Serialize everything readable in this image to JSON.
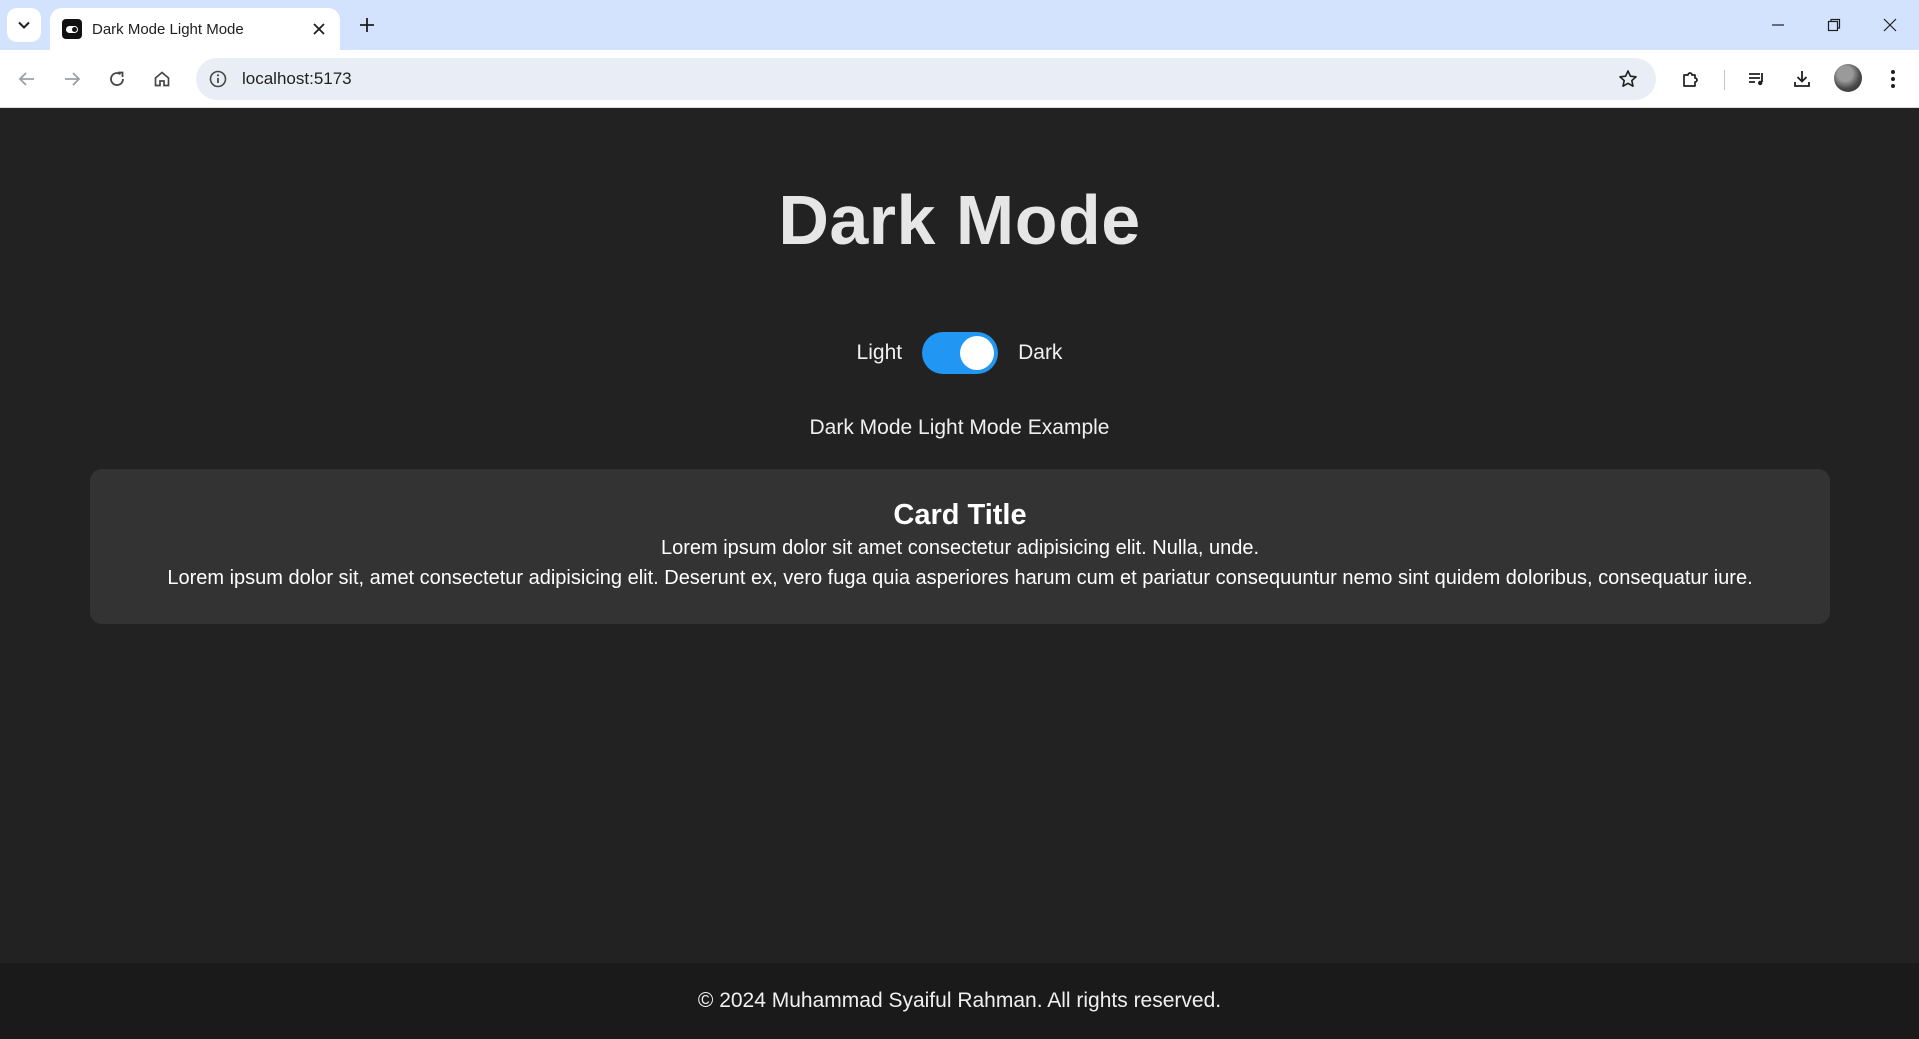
{
  "browser": {
    "tab": {
      "title": "Dark Mode Light Mode",
      "favicon": "toggle-icon"
    },
    "address_bar": {
      "url": "localhost:5173"
    },
    "icons": {
      "tab_search": "chevron-down-icon",
      "tab_close": "close-icon",
      "new_tab": "plus-icon",
      "minimize": "minimize-icon",
      "restore": "restore-icon",
      "close_window": "close-icon",
      "back": "arrow-left-icon",
      "forward": "arrow-right-icon",
      "reload": "reload-icon",
      "home": "home-icon",
      "site_info": "info-icon",
      "bookmark": "star-icon",
      "extensions": "puzzle-icon",
      "media": "media-queue-icon",
      "downloads": "download-icon",
      "profile": "avatar",
      "menu": "kebab-menu-icon"
    }
  },
  "page": {
    "title": "Dark Mode",
    "toggle": {
      "left_label": "Light",
      "right_label": "Dark",
      "checked": true,
      "color": "#2196f3"
    },
    "subtitle": "Dark Mode Light Mode Example",
    "card": {
      "title": "Card Title",
      "lines": [
        "Lorem ipsum dolor sit amet consectetur adipisicing elit. Nulla, unde.",
        "Lorem ipsum dolor sit, amet consectetur adipisicing elit. Deserunt ex, vero fuga quia asperiores harum cum et pariatur consequuntur nemo sint quidem doloribus, consequatur iure."
      ]
    },
    "footer": {
      "text": "© 2024 Muhammad Syaiful Rahman. All rights reserved."
    },
    "colors": {
      "background": "#222222",
      "card": "#333333",
      "footer": "#1a1a1a",
      "accent": "#2196f3"
    }
  }
}
